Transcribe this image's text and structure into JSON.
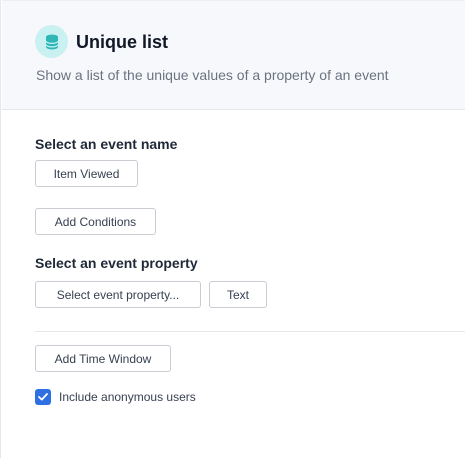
{
  "header": {
    "icon": "database-icon",
    "icon_color": "#2fb6b6",
    "icon_bg": "#c9f1f1",
    "title": "Unique list",
    "subtitle": "Show a list of the unique values of a property of an event"
  },
  "event_name": {
    "label": "Select an event name",
    "selected": "Item Viewed"
  },
  "conditions": {
    "button_label": "Add Conditions"
  },
  "event_property": {
    "label": "Select an event property",
    "selector_label": "Select event property...",
    "type_label": "Text"
  },
  "time_window": {
    "button_label": "Add Time Window"
  },
  "anonymous": {
    "label": "Include anonymous users",
    "checked": true,
    "accent": "#2f6fe4"
  }
}
